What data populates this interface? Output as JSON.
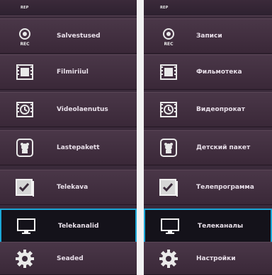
{
  "left_menu": {
    "top_label": "REP",
    "items": [
      {
        "label": "Salvestused",
        "icon": "rec-icon",
        "selected": false
      },
      {
        "label": "Filmiriiul",
        "icon": "film-icon",
        "selected": false
      },
      {
        "label": "Videolaenutus",
        "icon": "video-clock-icon",
        "selected": false
      },
      {
        "label": "Lastepakett",
        "icon": "kids-bear-icon",
        "selected": false
      },
      {
        "label": "Telekava",
        "icon": "checkbox-icon",
        "selected": false
      },
      {
        "label": "Telekanalid",
        "icon": "tv-monitor-icon",
        "selected": true
      },
      {
        "label": "Seaded",
        "icon": "gear-icon",
        "selected": false
      }
    ]
  },
  "right_menu": {
    "top_label": "REP",
    "items": [
      {
        "label": "Записи",
        "icon": "rec-icon",
        "selected": false
      },
      {
        "label": "Фильмотека",
        "icon": "film-icon",
        "selected": false
      },
      {
        "label": "Видеопрокат",
        "icon": "video-clock-icon",
        "selected": false
      },
      {
        "label": "Детский пакет",
        "icon": "kids-bear-icon",
        "selected": false
      },
      {
        "label": "Телепрограмма",
        "icon": "checkbox-icon",
        "selected": false
      },
      {
        "label": "Телеканалы",
        "icon": "tv-monitor-icon",
        "selected": true
      },
      {
        "label": "Настройки",
        "icon": "gear-icon",
        "selected": false
      }
    ]
  },
  "colors": {
    "panel_bg": "#3a2a3a",
    "selected_bg": "#14121a",
    "selected_border": "#1aa7d7",
    "label": "#e9e0ea",
    "icon": "#e9e9e9"
  }
}
